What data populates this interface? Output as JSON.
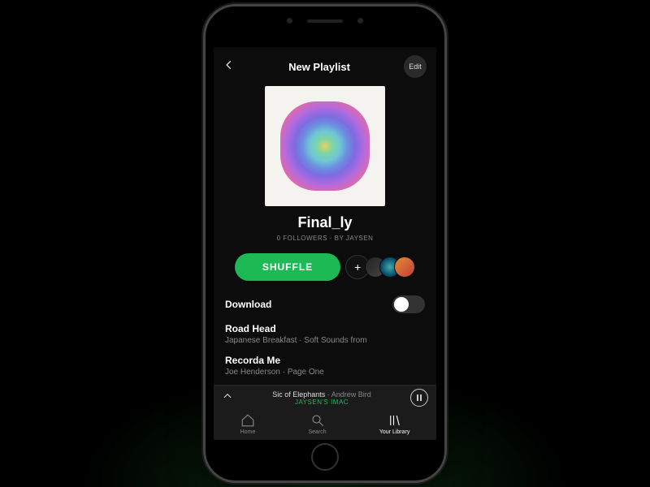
{
  "header": {
    "title": "New Playlist",
    "edit": "Edit"
  },
  "playlist": {
    "name": "Final_ly",
    "byline": "0 FOLLOWERS · BY JAYSEN",
    "shuffle": "SHUFFLE",
    "download": "Download"
  },
  "tracks": [
    {
      "name": "Road Head",
      "meta": "Japanese Breakfast · Soft Sounds from"
    },
    {
      "name": "Recorda Me",
      "meta": "Joe Henderson · Page One"
    }
  ],
  "nowplaying": {
    "title": "Sic of Elephants",
    "artist": "Andrew Bird",
    "device": "JAYSEN'S IMAC"
  },
  "tabs": {
    "home": "Home",
    "search": "Search",
    "library": "Your Library"
  }
}
